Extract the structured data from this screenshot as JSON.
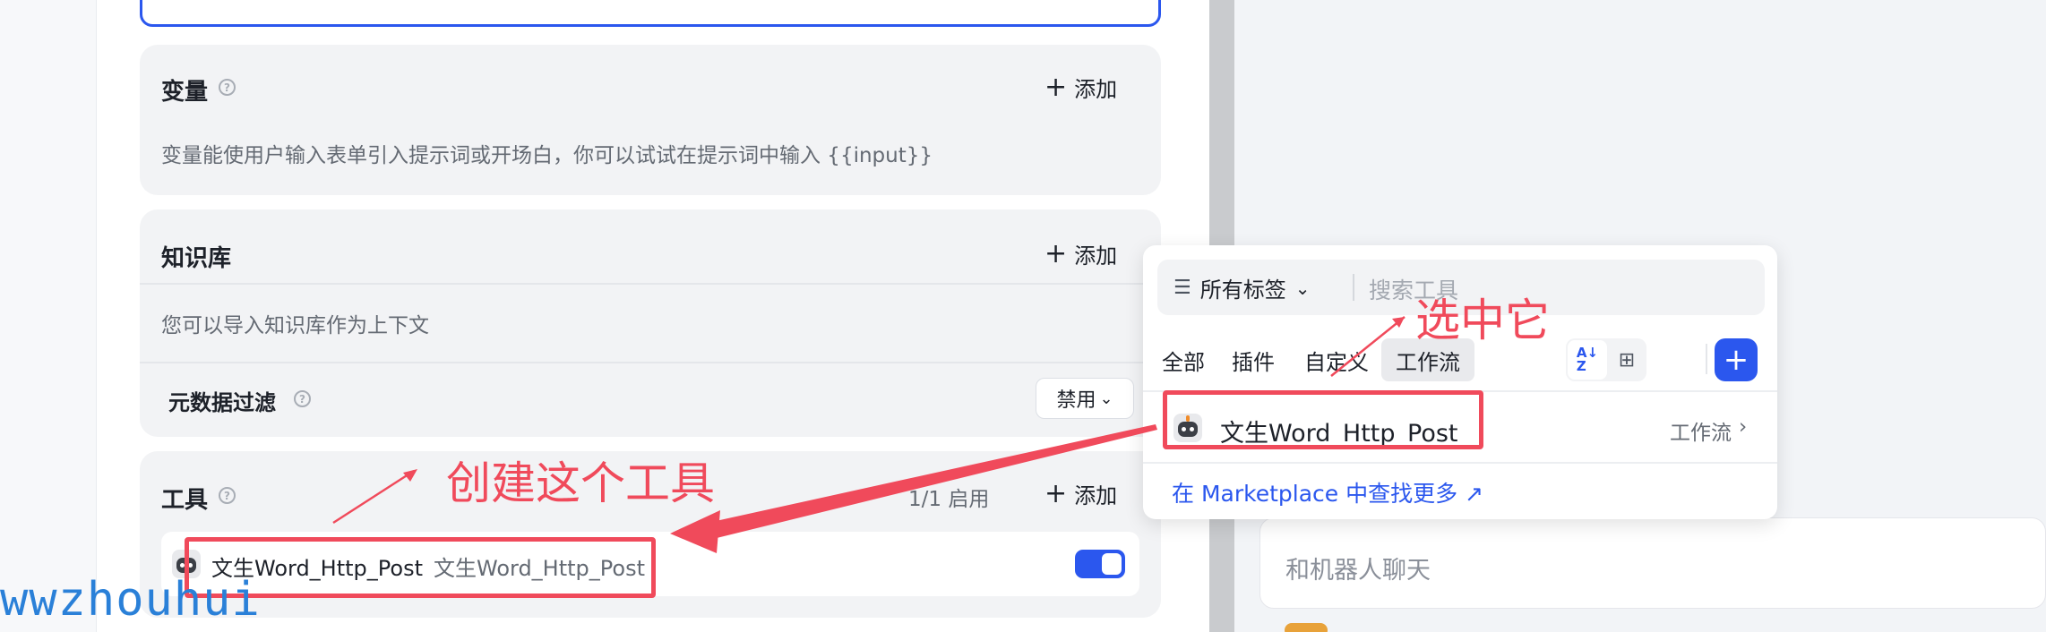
{
  "variables": {
    "title": "变量",
    "help": "?",
    "add_label": "添加",
    "description": "变量能使用户输入表单引入提示词或开场白，你可以试试在提示词中输入 {{input}}"
  },
  "knowledge": {
    "title": "知识库",
    "add_label": "添加",
    "description": "您可以导入知识库作为上下文",
    "metadata_filter_label": "元数据过滤",
    "metadata_filter_value": "禁用"
  },
  "tools": {
    "title": "工具",
    "enabled_count": "1/1 启用",
    "add_label": "添加",
    "item": {
      "name": "文生Word_Http_Post",
      "description": "文生Word_Http_Post",
      "enabled": true
    }
  },
  "tool_picker": {
    "filter_label": "所有标签",
    "search_placeholder": "搜索工具",
    "tabs": [
      "全部",
      "插件",
      "自定义",
      "工作流"
    ],
    "active_tab": "工作流",
    "result": {
      "name": "文生Word_Http_Post",
      "type": "工作流"
    },
    "marketplace_link": "在 Marketplace 中查找更多 ↗"
  },
  "chat": {
    "placeholder": "和机器人聊天"
  },
  "annotations": {
    "select_it": "选中它",
    "create_tool": "创建这个工具"
  },
  "watermark": "wwzhouhui",
  "colors": {
    "accent": "#2b57ee",
    "annotation": "#f04a5b",
    "watermark": "#2a80d8"
  }
}
